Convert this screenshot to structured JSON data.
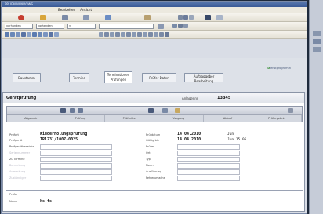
{
  "window": {
    "title": "PRUFM-WINDOWS"
  },
  "menu": [
    "Bearbeiten",
    "Ansicht"
  ],
  "combos": [
    "vorhanden",
    "vorhanden",
    "y"
  ],
  "tabs": [
    "Baustamm",
    "Termine",
    "Terminationen Prüfungen",
    "Prüfer Daten",
    "Auftraggeber Bearbeitung"
  ],
  "logo": {
    "prefix": "D",
    "text": "ienstprogramm"
  },
  "panel": {
    "title": "Gerätprüfung",
    "auftrag_label": "Anlagennr.",
    "auftrag_value": "13345",
    "columns": [
      "Allgemein",
      "Prüfung",
      "Prüfmittel",
      "Vorgang",
      "Ablauf",
      "Prüfergebnis"
    ]
  },
  "details": {
    "left": {
      "labels": [
        "Prüfart",
        "Prüfgerät"
      ],
      "values": [
        "Wiederholungsprüfung",
        "TR1231/1007-0025"
      ],
      "sublabels": [
        "Prüfgerätbezeichn.",
        "Seriennummer",
        "Zu Termine",
        "Bemerkung",
        "Anmerkung",
        "Zuständiger"
      ]
    },
    "right": {
      "labels": [
        "Prüfdatum",
        "Gültig bis"
      ],
      "dates": [
        "14.04.2010",
        "14.04.2010"
      ],
      "extra": [
        "Jun",
        "Jun 15:05"
      ],
      "sublabels": [
        "Prüfer",
        "Ort",
        "Typ",
        "Norm",
        "Ausführung",
        "Fehlerursache"
      ]
    },
    "footer": {
      "label1": "Prüfer",
      "label2": "Name",
      "value": "ks fs"
    }
  }
}
